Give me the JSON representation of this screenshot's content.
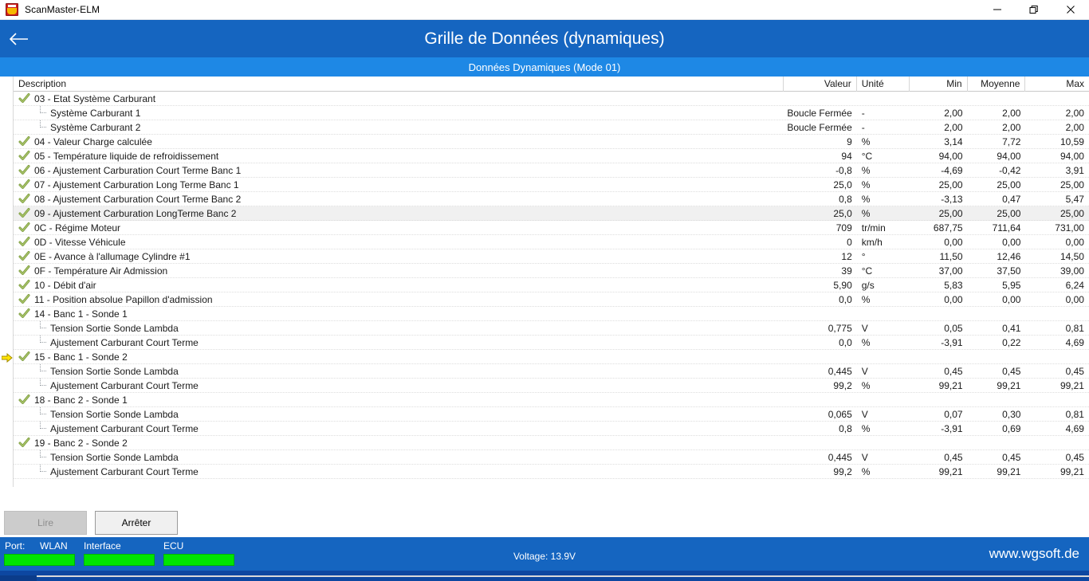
{
  "window": {
    "app_title": "ScanMaster-ELM",
    "app_icon": "obd-logo-icon",
    "minimize_label": "minimize-icon",
    "restore_label": "restore-icon",
    "close_label": "close-icon"
  },
  "header": {
    "back_icon": "back-arrow-icon",
    "title": "Grille de Données (dynamiques)",
    "subtitle": "Données Dynamiques (Mode 01)",
    "accent_color": "#1565c0",
    "subaccent_color": "#1e88e5"
  },
  "grid": {
    "columns": [
      "Description",
      "Valeur",
      "Unité",
      "Min",
      "Moyenne",
      "Max"
    ],
    "rows": [
      {
        "level": 0,
        "icon": "check-icon",
        "desc": "03 - Etat Système Carburant",
        "valeur": "",
        "unite": "",
        "min": "",
        "moyenne": "",
        "max": "",
        "alt": false,
        "marker": false
      },
      {
        "level": 1,
        "icon": "tree-branch-icon",
        "desc": "Système Carburant 1",
        "valeur": "Boucle Fermée",
        "unite": "-",
        "min": "2,00",
        "moyenne": "2,00",
        "max": "2,00",
        "alt": false,
        "marker": false
      },
      {
        "level": 1,
        "icon": "tree-branch-last-icon",
        "desc": "Système Carburant 2",
        "valeur": "Boucle Fermée",
        "unite": "-",
        "min": "2,00",
        "moyenne": "2,00",
        "max": "2,00",
        "alt": false,
        "marker": false
      },
      {
        "level": 0,
        "icon": "check-icon",
        "desc": "04 - Valeur Charge calculée",
        "valeur": "9",
        "unite": "%",
        "min": "3,14",
        "moyenne": "7,72",
        "max": "10,59",
        "alt": false,
        "marker": false
      },
      {
        "level": 0,
        "icon": "check-icon",
        "desc": "05 - Température liquide de refroidissement",
        "valeur": "94",
        "unite": "°C",
        "min": "94,00",
        "moyenne": "94,00",
        "max": "94,00",
        "alt": false,
        "marker": false
      },
      {
        "level": 0,
        "icon": "check-icon",
        "desc": "06 - Ajustement Carburation Court Terme Banc 1",
        "valeur": "-0,8",
        "unite": "%",
        "min": "-4,69",
        "moyenne": "-0,42",
        "max": "3,91",
        "alt": false,
        "marker": false
      },
      {
        "level": 0,
        "icon": "check-icon",
        "desc": "07 - Ajustement Carburation Long Terme Banc 1",
        "valeur": "25,0",
        "unite": "%",
        "min": "25,00",
        "moyenne": "25,00",
        "max": "25,00",
        "alt": false,
        "marker": false
      },
      {
        "level": 0,
        "icon": "check-icon",
        "desc": "08 - Ajustement Carburation Court Terme Banc 2",
        "valeur": "0,8",
        "unite": "%",
        "min": "-3,13",
        "moyenne": "0,47",
        "max": "5,47",
        "alt": false,
        "marker": false
      },
      {
        "level": 0,
        "icon": "check-icon",
        "desc": "09 - Ajustement Carburation LongTerme Banc 2",
        "valeur": "25,0",
        "unite": "%",
        "min": "25,00",
        "moyenne": "25,00",
        "max": "25,00",
        "alt": true,
        "marker": false
      },
      {
        "level": 0,
        "icon": "check-icon",
        "desc": "0C - Régime Moteur",
        "valeur": "709",
        "unite": "tr/min",
        "min": "687,75",
        "moyenne": "711,64",
        "max": "731,00",
        "alt": false,
        "marker": false
      },
      {
        "level": 0,
        "icon": "check-icon",
        "desc": "0D - Vitesse Véhicule",
        "valeur": "0",
        "unite": "km/h",
        "min": "0,00",
        "moyenne": "0,00",
        "max": "0,00",
        "alt": false,
        "marker": false
      },
      {
        "level": 0,
        "icon": "check-icon",
        "desc": "0E - Avance à l'allumage Cylindre #1",
        "valeur": "12",
        "unite": "°",
        "min": "11,50",
        "moyenne": "12,46",
        "max": "14,50",
        "alt": false,
        "marker": false
      },
      {
        "level": 0,
        "icon": "check-icon",
        "desc": "0F - Température Air Admission",
        "valeur": "39",
        "unite": "°C",
        "min": "37,00",
        "moyenne": "37,50",
        "max": "39,00",
        "alt": false,
        "marker": false
      },
      {
        "level": 0,
        "icon": "check-icon",
        "desc": "10 - Débit d'air",
        "valeur": "5,90",
        "unite": "g/s",
        "min": "5,83",
        "moyenne": "5,95",
        "max": "6,24",
        "alt": false,
        "marker": false
      },
      {
        "level": 0,
        "icon": "check-icon",
        "desc": "11 - Position absolue Papillon d'admission",
        "valeur": "0,0",
        "unite": "%",
        "min": "0,00",
        "moyenne": "0,00",
        "max": "0,00",
        "alt": false,
        "marker": false
      },
      {
        "level": 0,
        "icon": "check-icon",
        "desc": "14 - Banc 1 - Sonde 1",
        "valeur": "",
        "unite": "",
        "min": "",
        "moyenne": "",
        "max": "",
        "alt": false,
        "marker": false
      },
      {
        "level": 1,
        "icon": "tree-branch-icon",
        "desc": "Tension Sortie Sonde Lambda",
        "valeur": "0,775",
        "unite": "V",
        "min": "0,05",
        "moyenne": "0,41",
        "max": "0,81",
        "alt": false,
        "marker": false
      },
      {
        "level": 1,
        "icon": "tree-branch-last-icon",
        "desc": "Ajustement Carburant Court Terme",
        "valeur": "0,0",
        "unite": "%",
        "min": "-3,91",
        "moyenne": "0,22",
        "max": "4,69",
        "alt": false,
        "marker": false
      },
      {
        "level": 0,
        "icon": "check-icon",
        "desc": "15 - Banc 1 - Sonde 2",
        "valeur": "",
        "unite": "",
        "min": "",
        "moyenne": "",
        "max": "",
        "alt": false,
        "marker": true
      },
      {
        "level": 1,
        "icon": "tree-branch-icon",
        "desc": "Tension Sortie Sonde Lambda",
        "valeur": "0,445",
        "unite": "V",
        "min": "0,45",
        "moyenne": "0,45",
        "max": "0,45",
        "alt": false,
        "marker": false
      },
      {
        "level": 1,
        "icon": "tree-branch-last-icon",
        "desc": "Ajustement Carburant Court Terme",
        "valeur": "99,2",
        "unite": "%",
        "min": "99,21",
        "moyenne": "99,21",
        "max": "99,21",
        "alt": false,
        "marker": false
      },
      {
        "level": 0,
        "icon": "check-icon",
        "desc": "18 - Banc 2 - Sonde 1",
        "valeur": "",
        "unite": "",
        "min": "",
        "moyenne": "",
        "max": "",
        "alt": false,
        "marker": false
      },
      {
        "level": 1,
        "icon": "tree-branch-icon",
        "desc": "Tension Sortie Sonde Lambda",
        "valeur": "0,065",
        "unite": "V",
        "min": "0,07",
        "moyenne": "0,30",
        "max": "0,81",
        "alt": false,
        "marker": false
      },
      {
        "level": 1,
        "icon": "tree-branch-last-icon",
        "desc": "Ajustement Carburant Court Terme",
        "valeur": "0,8",
        "unite": "%",
        "min": "-3,91",
        "moyenne": "0,69",
        "max": "4,69",
        "alt": false,
        "marker": false
      },
      {
        "level": 0,
        "icon": "check-icon",
        "desc": "19 - Banc 2 - Sonde 2",
        "valeur": "",
        "unite": "",
        "min": "",
        "moyenne": "",
        "max": "",
        "alt": false,
        "marker": false
      },
      {
        "level": 1,
        "icon": "tree-branch-icon",
        "desc": "Tension Sortie Sonde Lambda",
        "valeur": "0,445",
        "unite": "V",
        "min": "0,45",
        "moyenne": "0,45",
        "max": "0,45",
        "alt": false,
        "marker": false
      },
      {
        "level": 1,
        "icon": "tree-branch-last-icon",
        "desc": "Ajustement Carburant Court Terme",
        "valeur": "99,2",
        "unite": "%",
        "min": "99,21",
        "moyenne": "99,21",
        "max": "99,21",
        "alt": false,
        "marker": false
      }
    ]
  },
  "buttons": {
    "read": "Lire",
    "read_enabled": false,
    "stop": "Arrêter",
    "stop_enabled": true
  },
  "status": {
    "port_label": "Port:",
    "connection": "WLAN",
    "interface_label": "Interface",
    "ecu_label": "ECU",
    "voltage": "Voltage: 13.9V",
    "url": "www.wgsoft.de",
    "led_color": "#00e500",
    "led_port_state": "ok",
    "led_interface_state": "ok",
    "led_ecu_state": "ok"
  }
}
